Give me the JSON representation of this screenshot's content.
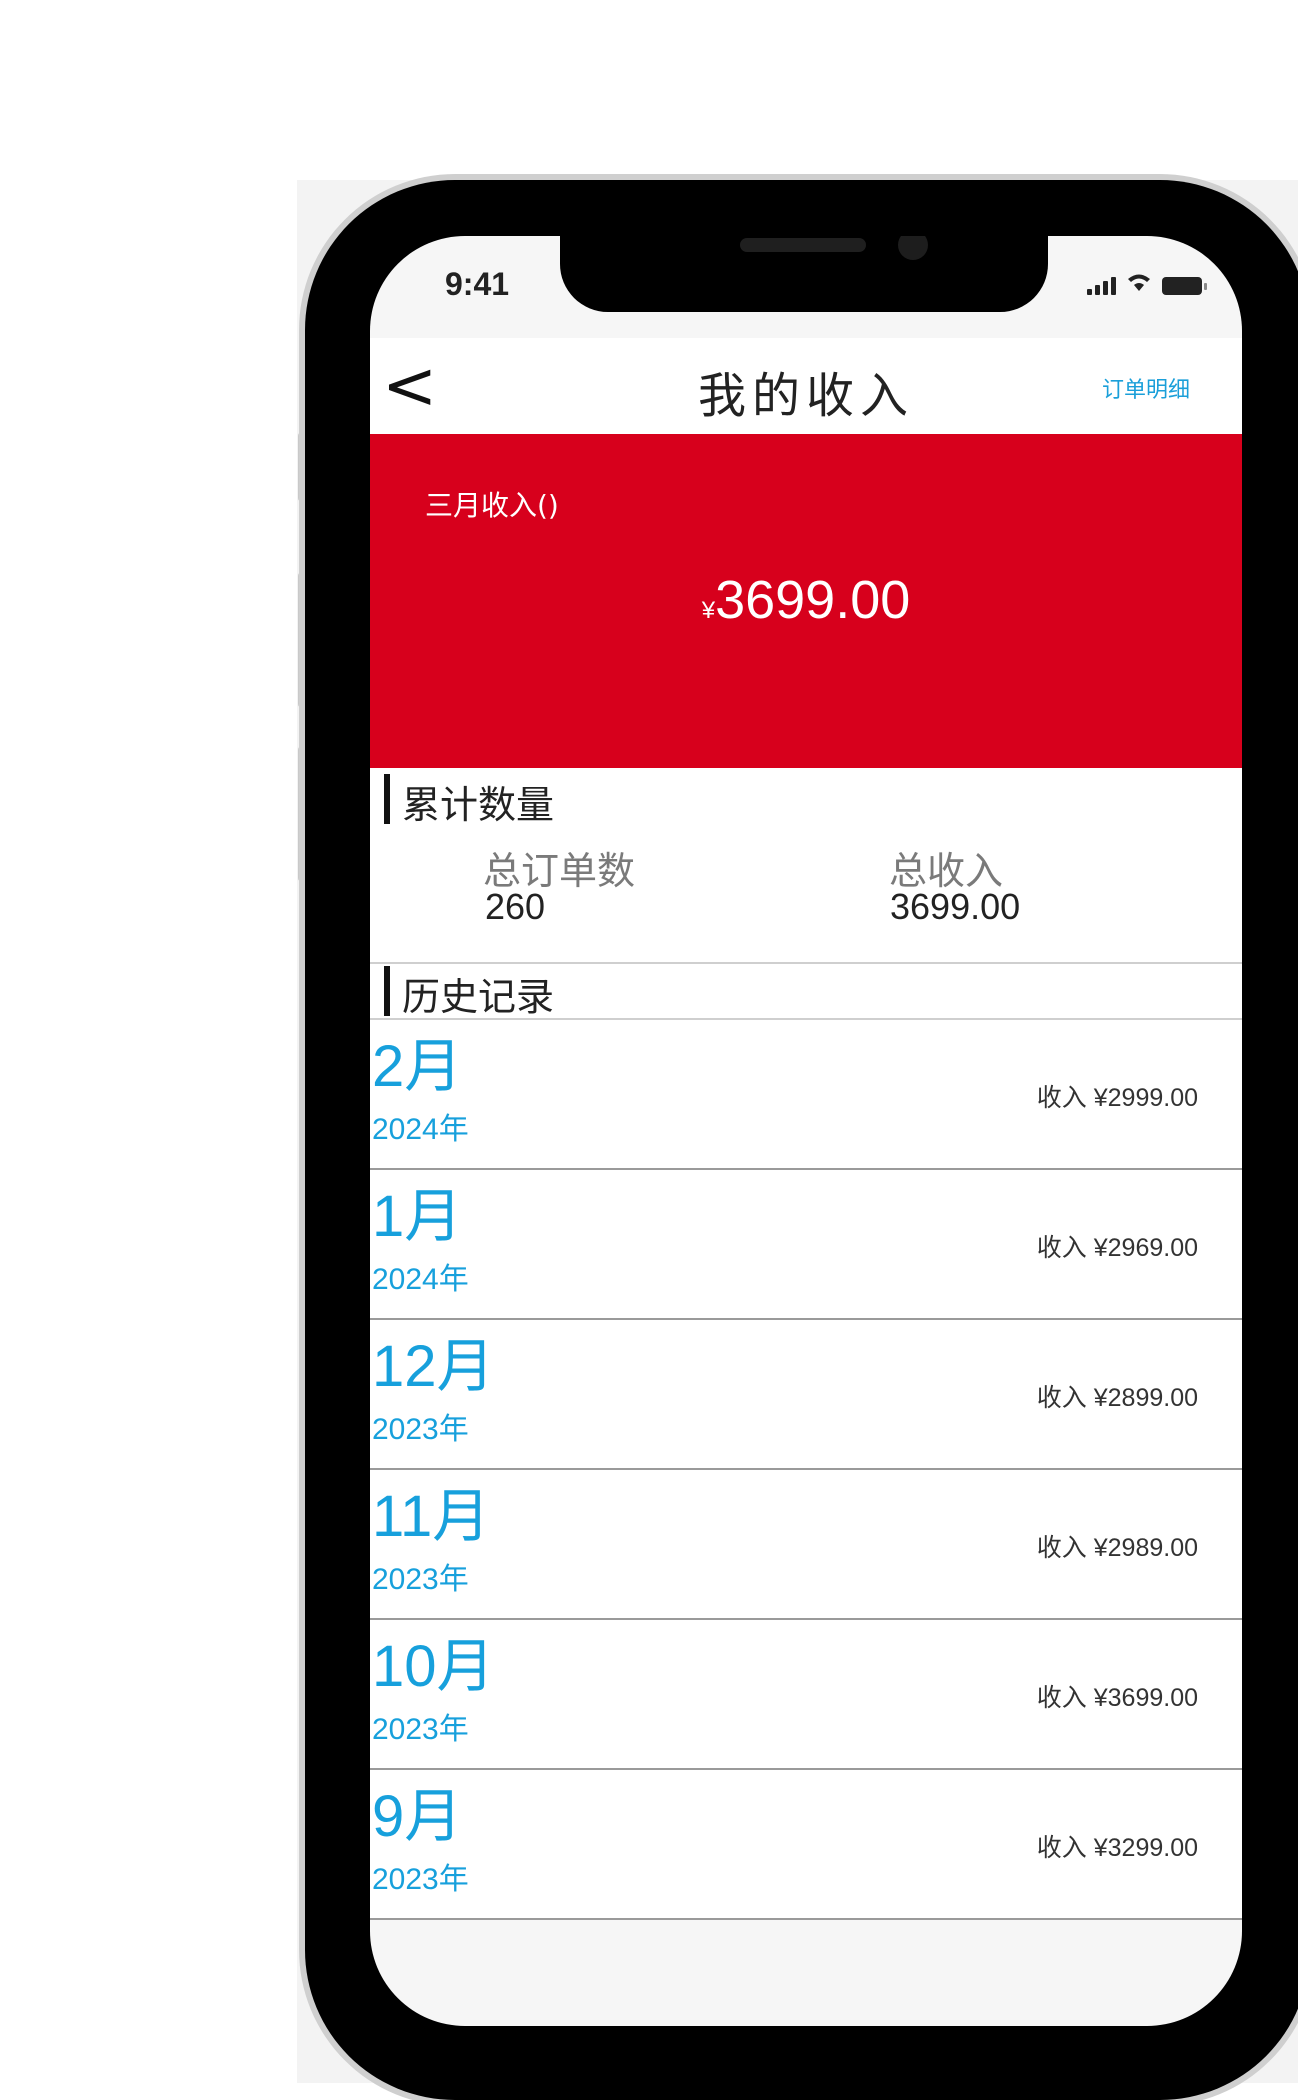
{
  "status": {
    "time": "9:41",
    "icons": [
      "signal-icon",
      "wifi-icon",
      "battery-icon"
    ]
  },
  "header": {
    "back_label": "<",
    "title": "我的收入",
    "orders_link": "订单明细"
  },
  "banner": {
    "label": "三月收入()",
    "currency": "¥",
    "amount": "3699.00",
    "color": "#d7001c"
  },
  "summary": {
    "title": "累计数量",
    "total_orders_label": "总订单数",
    "total_orders_value": "260",
    "total_income_label": "总收入",
    "total_income_value": "3699.00"
  },
  "history": {
    "title": "历史记录",
    "records": [
      {
        "month": "2月",
        "year": "2024年",
        "amount": "收入 ¥2999.00"
      },
      {
        "month": "1月",
        "year": "2024年",
        "amount": "收入 ¥2969.00"
      },
      {
        "month": "12月",
        "year": "2023年",
        "amount": "收入 ¥2899.00"
      },
      {
        "month": "11月",
        "year": "2023年",
        "amount": "收入 ¥2989.00"
      },
      {
        "month": "10月",
        "year": "2023年",
        "amount": "收入 ¥3699.00"
      },
      {
        "month": "9月",
        "year": "2023年",
        "amount": "收入 ¥3299.00"
      }
    ]
  },
  "colors": {
    "accent": "#17a0dc",
    "banner": "#d7001c"
  }
}
